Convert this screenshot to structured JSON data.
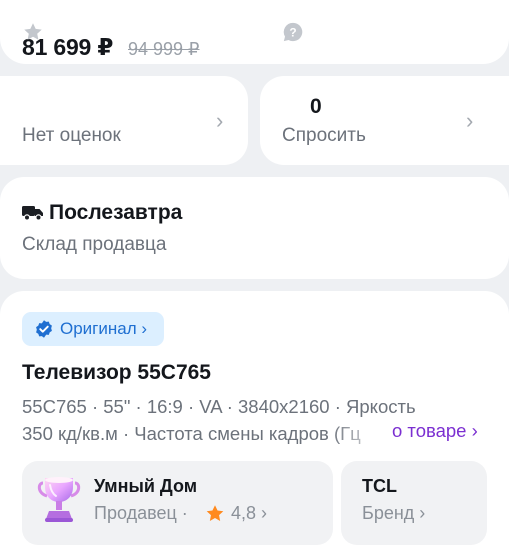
{
  "price": {
    "current": "81 699 ₽",
    "old": "94 999 ₽"
  },
  "reviews": {
    "icon": "star-icon",
    "label": "Нет оценок",
    "chevron": "›"
  },
  "questions": {
    "icon": "question-bubble-icon",
    "count": "0",
    "label": "Спросить",
    "chevron": "›"
  },
  "delivery": {
    "icon": "truck-icon",
    "title": "Послезавтра",
    "subtitle": "Склад продавца"
  },
  "product": {
    "badge": "Оригинал ›",
    "badge_icon": "verified-check-icon",
    "title": "Телевизор 55C765",
    "specs_line1": "55C765 · 55\" · 16:9 · VA · 3840x2160 · Яркость",
    "specs_line2": "350 кд/кв.м · Частота смены кадров (Гц",
    "about_link": "о товаре ›"
  },
  "seller": {
    "icon": "trophy-icon",
    "name": "Умный Дом",
    "role": "Продавец ·",
    "rating": "4,8 ›",
    "rating_icon": "star-icon"
  },
  "brand": {
    "name": "TCL",
    "role": "Бренд ›"
  },
  "colors": {
    "accent_blue": "#1f6fd1",
    "link_purple": "#7b2fd1",
    "star_orange": "#ff8a1f"
  }
}
